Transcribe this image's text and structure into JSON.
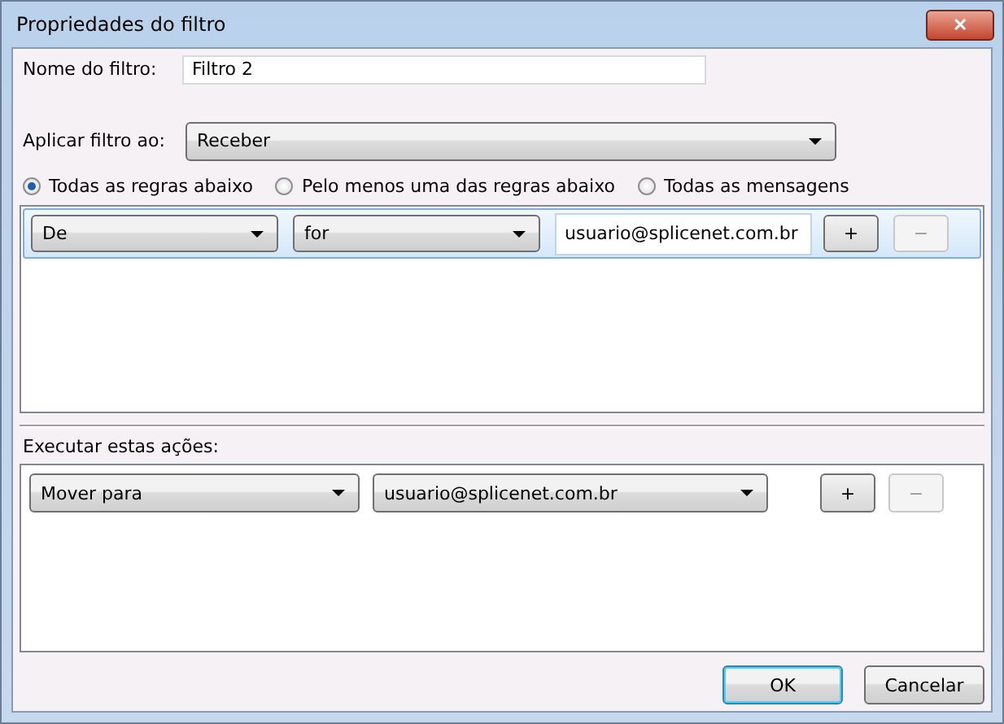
{
  "window": {
    "title": "Propriedades do filtro",
    "close": "✕"
  },
  "filter_name": {
    "label": "Nome do filtro:",
    "value": "Filtro 2"
  },
  "apply_to": {
    "label": "Aplicar filtro ao:",
    "value": "Receber"
  },
  "match_options": [
    {
      "label": "Todas as regras abaixo",
      "selected": true
    },
    {
      "label": "Pelo menos uma das regras abaixo",
      "selected": false
    },
    {
      "label": "Todas as mensagens",
      "selected": false
    }
  ],
  "rules": [
    {
      "field": "De",
      "operator": "for",
      "value": "usuario@splicenet.com.br",
      "selected": true,
      "add": {
        "label": "+",
        "disabled": false
      },
      "remove": {
        "label": "−",
        "disabled": true
      }
    }
  ],
  "actions_label": "Executar estas ações:",
  "actions": [
    {
      "action": "Mover para",
      "target": "usuario@splicenet.com.br",
      "add": {
        "label": "+",
        "disabled": false
      },
      "remove": {
        "label": "−",
        "disabled": true
      }
    }
  ],
  "buttons": [
    {
      "label": "OK",
      "default": true
    },
    {
      "label": "Cancelar",
      "default": false
    }
  ]
}
